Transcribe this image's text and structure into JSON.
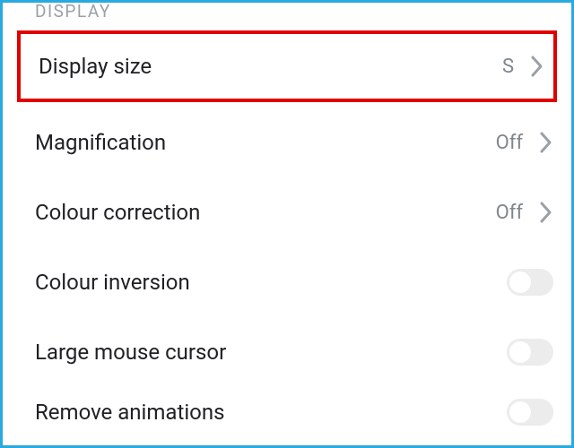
{
  "section": {
    "title": "DISPLAY"
  },
  "items": {
    "display_size": {
      "label": "Display size",
      "value": "S"
    },
    "magnification": {
      "label": "Magnification",
      "value": "Off"
    },
    "colour_correction": {
      "label": "Colour correction",
      "value": "Off"
    },
    "colour_inversion": {
      "label": "Colour inversion"
    },
    "large_mouse_cursor": {
      "label": "Large mouse cursor"
    },
    "remove_animations": {
      "label": "Remove animations"
    }
  }
}
